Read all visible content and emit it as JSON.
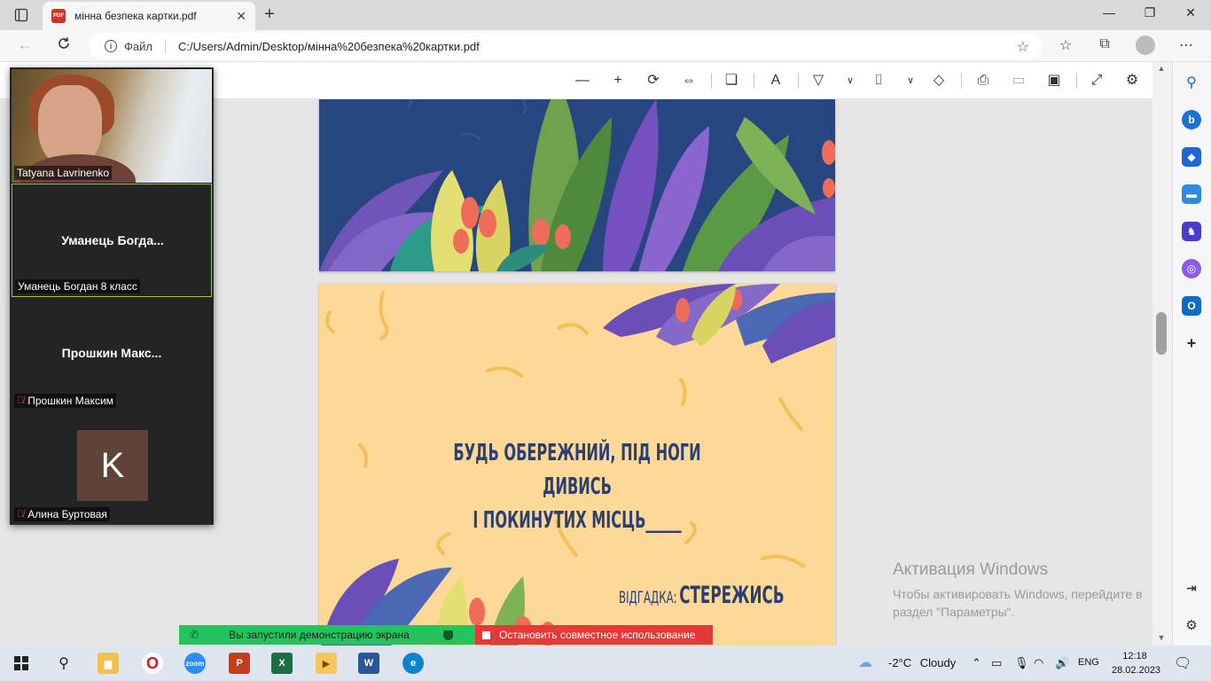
{
  "browser": {
    "tab_title": "мінна безпека картки.pdf",
    "new_tab_symbol": "+",
    "address": {
      "scheme": "Файл",
      "url": "C:/Users/Admin/Desktop/мінна%20безпека%20картки.pdf"
    }
  },
  "pdf": {
    "card_text_line1": "БУДЬ ОБЕРЕЖНИЙ, ПІД НОГИ ДИВИСЬ",
    "card_text_line2": "І ПОКИНУТИХ МІСЦЬ_____",
    "answer_label": "ВІДГАДКА:",
    "answer_value": "СТЕРЕЖИСЬ"
  },
  "zoom": {
    "participants": [
      {
        "tag": "Tatyana Lavrinenko",
        "video": true,
        "muted": false
      },
      {
        "center": "Уманець Богда...",
        "tag": "Уманець Богдан 8 класс",
        "muted": false,
        "active": true
      },
      {
        "center": "Прошкин Макс...",
        "tag": "Прошкин Максим",
        "muted": true
      },
      {
        "avatar_letter": "K",
        "tag": "Алина Буртовая",
        "muted": true,
        "avatar_color": "#5f4337"
      }
    ],
    "share_bar": {
      "status": "Вы запустили демонстрацию экрана",
      "stop": "Остановить совместное использование"
    }
  },
  "activation": {
    "title": "Активация Windows",
    "line1": "Чтобы активировать Windows, перейдите в",
    "line2": "раздел \"Параметры\"."
  },
  "taskbar": {
    "weather_temp": "-2°C",
    "weather_text": "Cloudy",
    "lang": "ENG",
    "time": "12:18",
    "date": "28.02.2023"
  },
  "icons": {
    "zoom_label": "zoom",
    "accent_colors": {
      "opera": "#e0141e",
      "zoom": "#2d8cff",
      "powerpoint": "#c43e1c",
      "excel": "#1d6f42",
      "word": "#2b579a",
      "edge": "#0c85d0"
    }
  }
}
